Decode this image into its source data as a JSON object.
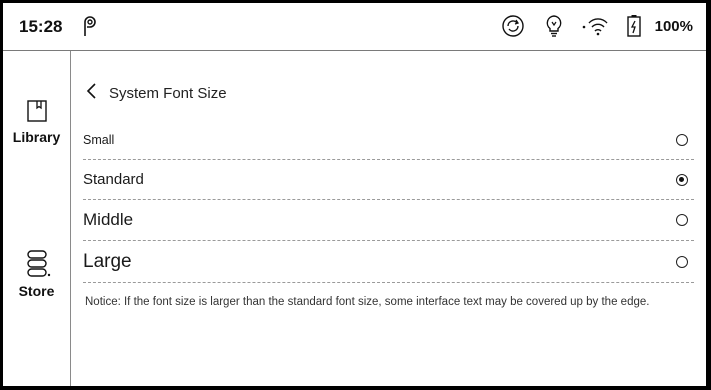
{
  "status_bar": {
    "time": "15:28",
    "battery_percent": "100%",
    "icons": [
      "pinned-app-icon",
      "sync-icon",
      "frontlight-icon",
      "wifi-icon",
      "battery-icon"
    ]
  },
  "sidebar": {
    "items": [
      {
        "label": "Library",
        "icon": "library-icon"
      },
      {
        "label": "Store",
        "icon": "store-icon"
      }
    ]
  },
  "page": {
    "title": "System Font Size",
    "options": [
      {
        "label": "Small",
        "selected": false
      },
      {
        "label": "Standard",
        "selected": true
      },
      {
        "label": "Middle",
        "selected": false
      },
      {
        "label": "Large",
        "selected": false
      }
    ],
    "notice": "Notice: If the font size is larger than the standard font size, some interface text may be covered up by the edge."
  }
}
